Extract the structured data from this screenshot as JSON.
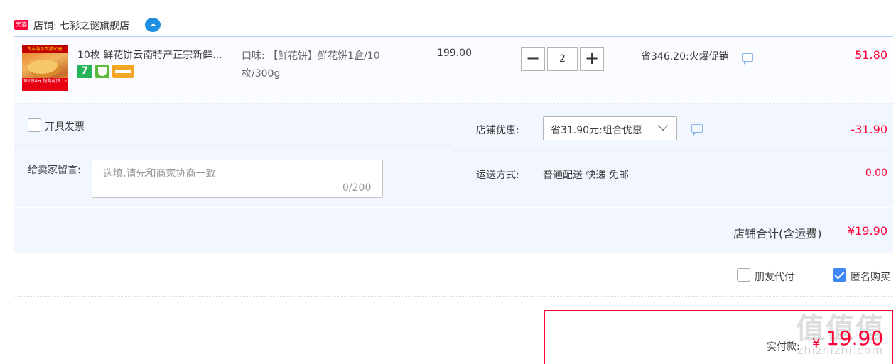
{
  "shop": {
    "badge": "天猫",
    "name": "店铺: 七彩之谜旗舰店"
  },
  "product": {
    "image_top_text": "专本购单立减10元",
    "image_bottom_text": "第2份4元 抢购花饼 15.9",
    "title": "10枚 鲜花饼云南特产正宗新鲜...",
    "badge_7": "7",
    "sku": "口味: 【鲜花饼】鲜花饼1盒/10枚/300g",
    "unit_price": "199.00",
    "quantity": "2",
    "qty_minus": "−",
    "qty_plus": "+",
    "promotion": "省346.20:火爆促销",
    "subtotal": "51.80"
  },
  "options": {
    "invoice_label": "开具发票",
    "message_label": "给卖家留言:",
    "message_placeholder": "选填,请先和商家协商一致",
    "message_count": "0/200",
    "shop_discount_label": "店铺优惠:",
    "shop_discount_selected": "省31.90元:组合优惠",
    "shop_discount_amount": "-31.90",
    "shipping_label": "运送方式:",
    "shipping_value": "普通配送 快递 免邮",
    "shipping_fee": "0.00"
  },
  "total": {
    "label": "店铺合计(含运费)",
    "amount": "¥19.90"
  },
  "extras": {
    "friend_pay_label": "朋友代付",
    "friend_pay_checked": false,
    "anonymous_label": "匿名购买",
    "anonymous_checked": true
  },
  "payment": {
    "label": "实付款:",
    "currency": "¥",
    "amount": "19.90"
  },
  "watermark": {
    "text": "值值值",
    "sub": "zhizhizhi.com"
  },
  "colors": {
    "price_red": "#ff0036",
    "panel_bg": "#f2f7ff",
    "checkbox_blue": "#3f86f8",
    "tmall_red": "#ff0036"
  },
  "icons": {
    "shop_badge": "tmall-icon",
    "wangwang": "wangwang-chat-icon",
    "promo_chat": "chat-bubble-icon",
    "dropdown": "chevron-down-icon"
  }
}
